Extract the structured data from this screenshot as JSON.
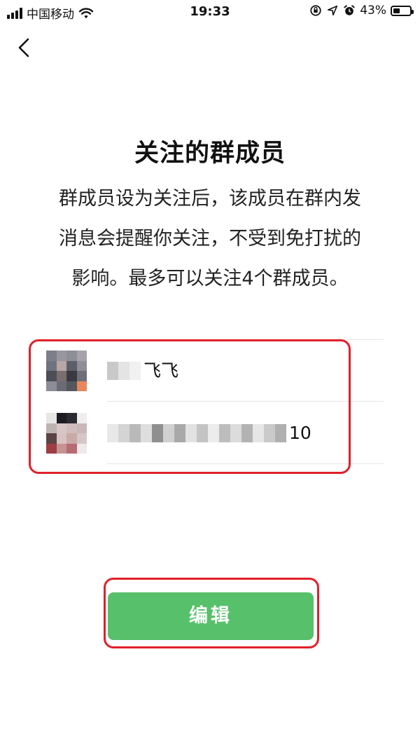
{
  "status_bar": {
    "carrier": "中国移动",
    "time": "19:33",
    "battery": "43%",
    "battery_level": 0.43
  },
  "page": {
    "title": "关注的群成员",
    "description_lines": [
      "群成员设为关注后，该成员在群内发",
      "消息会提醒你关注，不受到免打扰的",
      "影响。最多可以关注4个群成员。"
    ]
  },
  "members": [
    {
      "name_suffix": "飞飞"
    },
    {
      "name_suffix": "10"
    }
  ],
  "actions": {
    "edit_label": "编辑"
  },
  "colors": {
    "accent_green": "#57c06a",
    "highlight_red": "#e0202a"
  },
  "icons": [
    "cellular-signal-icon",
    "wifi-icon",
    "orientation-lock-icon",
    "location-arrow-icon",
    "alarm-icon",
    "battery-icon",
    "back-chevron-icon"
  ]
}
